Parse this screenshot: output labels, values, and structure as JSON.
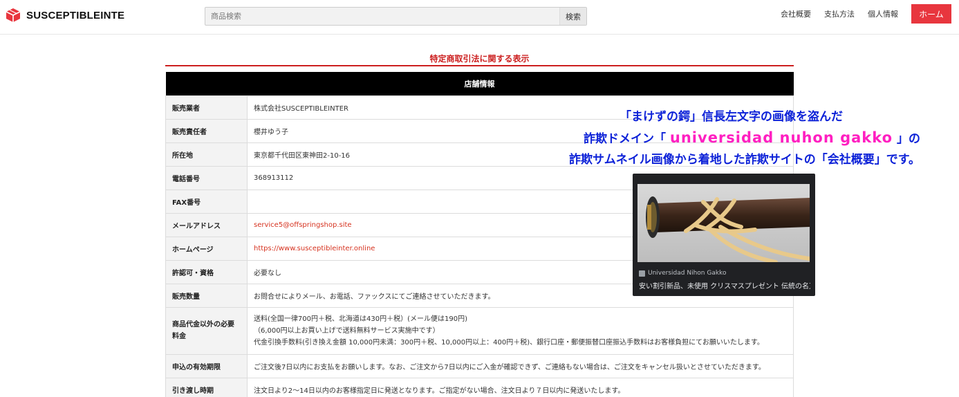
{
  "header": {
    "brand": "SUSCEPTIBLEINTE",
    "search_placeholder": "商品検索",
    "search_button": "検索",
    "nav": {
      "company": "会社概要",
      "payment": "支払方法",
      "privacy": "個人情報",
      "home": "ホーム"
    }
  },
  "section_title": "特定商取引法に関する表示",
  "table": {
    "heading": "店舗情報",
    "rows": {
      "seller_label": "販売業者",
      "seller_value": "株式会社SUSCEPTIBLEINTER",
      "manager_label": "販売責任者",
      "manager_value": "櫻井ゆう子",
      "address_label": "所在地",
      "address_value": "東京都千代田区東神田2-10-16",
      "tel_label": "電話番号",
      "tel_value": "368913112",
      "fax_label": "FAX番号",
      "fax_value": "",
      "email_label": "メールアドレス",
      "email_value": "service5@offspringshop.site",
      "homepage_label": "ホームページ",
      "homepage_value": "https://www.susceptibleinter.online",
      "license_label": "許認可・資格",
      "license_value": "必要なし",
      "quantity_label": "販売数量",
      "quantity_value": "お問合せによりメール、お電話、ファックスにてご連絡させていただきます。",
      "fees_label_1": "商品代金以外の必要",
      "fees_label_2": "料金",
      "fees_line1": "送料(全国一律700円＋税、北海道は430円＋税）(メール便は190円)",
      "fees_line2": "（6,000円以上お買い上げで送料無料サービス実施中です）",
      "fees_line3": "代金引換手数料(引き換え金額 10,000円未満：300円＋税、10,000円以上：400円＋税)、銀行口座・郵便振替口座振込手数料はお客様負担にてお願いいたします。",
      "deadline_label": "申込の有効期限",
      "deadline_value": "ご注文後7日以内にお支払をお願いします。なお、ご注文から7日以内にご入金が確認できず、ご連絡もない場合は、ご注文をキャンセル扱いとさせていただきます。",
      "delivery_label": "引き渡し時期",
      "delivery_value": "注文日より2～14日以内のお客様指定日に発送となります。ご指定がない場合、注文日より７日以内に発送いたします。"
    }
  },
  "annotation": {
    "line1": "「まけずの鍔」信長左文字の画像を盗んだ",
    "line2_pre": "詐欺ドメイン「",
    "line2_domain": "universidad nuhon gakko",
    "line2_post": "」の",
    "line3": "詐欺サムネイル画像から着地した詐欺サイトの「会社概要」です。"
  },
  "thumbnail": {
    "source": "Universidad Nihon Gakko",
    "title": "安い割引新品、未使用 クリスマスプレゼント 伝統の名刀 ..."
  },
  "colors": {
    "accent_red": "#e8363e",
    "title_red": "#cc1f1f",
    "link_red": "#d6321f",
    "annotation_blue": "#0d22d8",
    "annotation_pink": "#ff1fc1"
  }
}
